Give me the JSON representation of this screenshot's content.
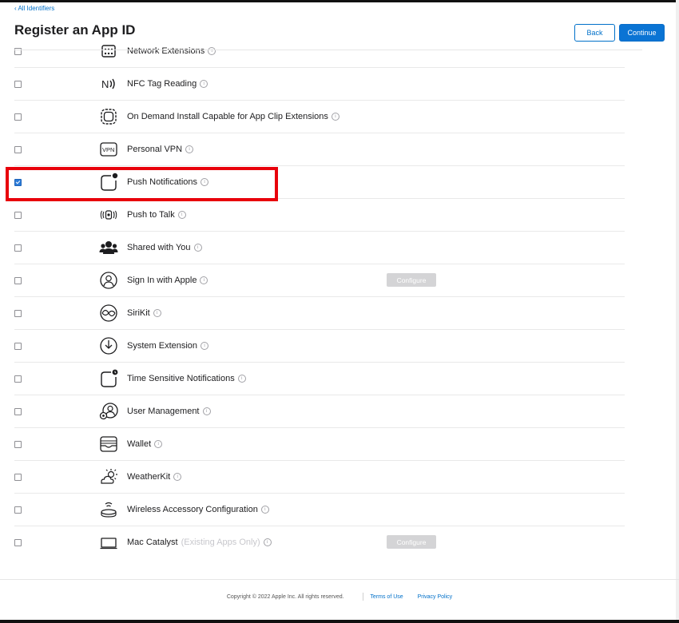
{
  "header": {
    "back_link": "‹ All Identifiers",
    "title": "Register an App ID",
    "back_button": "Back",
    "continue_button": "Continue"
  },
  "capabilities": [
    {
      "label": "Network Extensions",
      "checked": false,
      "icon": "network-extensions-icon"
    },
    {
      "label": "NFC Tag Reading",
      "checked": false,
      "icon": "nfc-icon"
    },
    {
      "label": "On Demand Install Capable for App Clip Extensions",
      "checked": false,
      "icon": "app-clip-icon"
    },
    {
      "label": "Personal VPN",
      "checked": false,
      "icon": "vpn-icon"
    },
    {
      "label": "Push Notifications",
      "checked": true,
      "icon": "push-notifications-icon"
    },
    {
      "label": "Push to Talk",
      "checked": false,
      "icon": "push-to-talk-icon"
    },
    {
      "label": "Shared with You",
      "checked": false,
      "icon": "shared-with-you-icon"
    },
    {
      "label": "Sign In with Apple",
      "checked": false,
      "icon": "sign-in-with-apple-icon",
      "configure": "Configure"
    },
    {
      "label": "SiriKit",
      "checked": false,
      "icon": "sirikit-icon"
    },
    {
      "label": "System Extension",
      "checked": false,
      "icon": "system-extension-icon"
    },
    {
      "label": "Time Sensitive Notifications",
      "checked": false,
      "icon": "time-sensitive-icon"
    },
    {
      "label": "User Management",
      "checked": false,
      "icon": "user-management-icon"
    },
    {
      "label": "Wallet",
      "checked": false,
      "icon": "wallet-icon"
    },
    {
      "label": "WeatherKit",
      "checked": false,
      "icon": "weatherkit-icon"
    },
    {
      "label": "Wireless Accessory Configuration",
      "checked": false,
      "icon": "wireless-accessory-icon"
    },
    {
      "label": "Mac Catalyst",
      "sublabel": "(Existing Apps Only)",
      "checked": false,
      "icon": "mac-catalyst-icon",
      "configure": "Configure"
    }
  ],
  "info_glyph": "i",
  "footer": {
    "copyright": "Copyright © 2022 Apple Inc. All rights reserved.",
    "terms": "Terms of Use",
    "privacy": "Privacy Policy"
  },
  "colors": {
    "accent": "#0070c9",
    "highlight": "#e8000b",
    "checkbox_checked": "#2b7bd8"
  }
}
